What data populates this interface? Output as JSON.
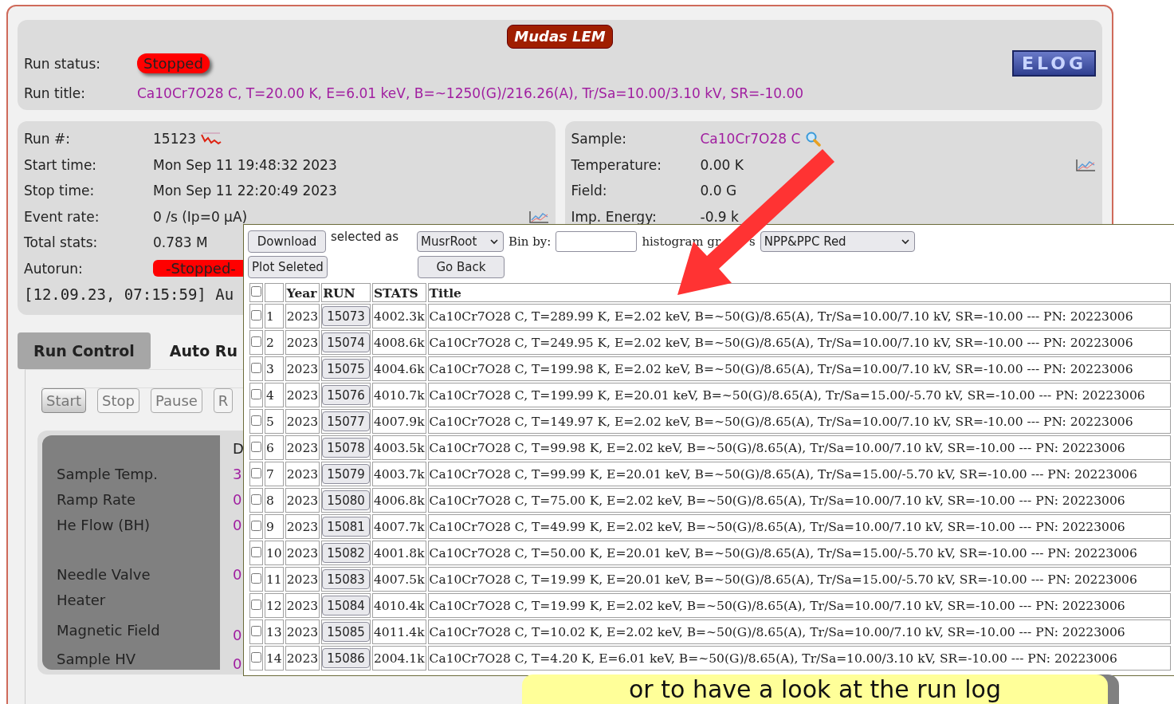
{
  "banner": "Mudas LEM",
  "logo": "ELOG",
  "run_status": {
    "label": "Run status:",
    "value": "Stopped"
  },
  "run_title": {
    "label": "Run title:",
    "value": "Ca10Cr7O28 C, T=20.00 K, E=6.01 keV, B=~1250(G)/216.26(A), Tr/Sa=10.00/3.10 kV, SR=-10.00"
  },
  "run_info": [
    {
      "kind": "run",
      "label": "Run #:",
      "value": "15123"
    },
    {
      "kind": "plain",
      "label": "Start time:",
      "value": "Mon Sep 11 19:48:32 2023"
    },
    {
      "kind": "plain",
      "label": "Stop time:",
      "value": "Mon Sep 11 22:20:49 2023"
    },
    {
      "kind": "rate",
      "label": "Event rate:",
      "value": "0 /s (Ip=0 μA)"
    },
    {
      "kind": "plain",
      "label": "Total stats:",
      "value": "0.783 M"
    },
    {
      "kind": "pill",
      "label": "Autorun:",
      "value": "-Stopped-"
    },
    {
      "kind": "log",
      "value": "[12.09.23, 07:15:59] Au"
    }
  ],
  "sample_info": [
    {
      "kind": "sample",
      "label": "Sample:",
      "value": "Ca10Cr7O28 C"
    },
    {
      "kind": "chart",
      "label": "Temperature:",
      "value": "0.00 K"
    },
    {
      "kind": "plain",
      "label": "Field:",
      "value": "0.0 G"
    },
    {
      "kind": "plain",
      "label": "Imp. Energy:",
      "value": "-0.9 k"
    }
  ],
  "tabs": [
    {
      "label": "Run Control",
      "selected": true
    },
    {
      "label": "Auto Ru",
      "selected": false
    }
  ],
  "controls": [
    {
      "label": "Start",
      "disabled": false
    },
    {
      "label": "Stop",
      "disabled": true
    },
    {
      "label": "Pause",
      "disabled": true
    },
    {
      "label": "R",
      "disabled": true
    }
  ],
  "readouts": {
    "header": "D",
    "rows": [
      {
        "label": "Sample Temp.",
        "value": "3"
      },
      {
        "label": "Ramp Rate",
        "value": "0"
      },
      {
        "label": "He Flow (BH)",
        "value": "0"
      },
      {
        "label": "Needle Valve",
        "value": "0"
      },
      {
        "label": "Heater"
      },
      {
        "label": "Magnetic Field",
        "value": "0"
      },
      {
        "label": "Sample HV",
        "value": "0"
      }
    ]
  },
  "popup": {
    "download": "Download",
    "selected_as": "selected as",
    "format": "MusrRoot",
    "bin_by": "Bin by:",
    "histogram_left": "histogram gr",
    "histogram_right": "s",
    "grouping": "NPP&PPC Red",
    "plot": "Plot Seleted",
    "back": "Go Back",
    "select_all": {
      "checked": false
    },
    "columns": [
      "Year",
      "RUN",
      "STATS",
      "Title"
    ],
    "rows": [
      {
        "checked": false,
        "n": "1",
        "year": "2023",
        "run": "15073",
        "stats": "4002.3k",
        "title": "Ca10Cr7O28 C, T=289.99 K, E=2.02 keV, B=~50(G)/8.65(A), Tr/Sa=10.00/7.10 kV, SR=-10.00 --- PN: 20223006"
      },
      {
        "checked": false,
        "n": "2",
        "year": "2023",
        "run": "15074",
        "stats": "4008.6k",
        "title": "Ca10Cr7O28 C, T=249.95 K, E=2.02 keV, B=~50(G)/8.65(A), Tr/Sa=10.00/7.10 kV, SR=-10.00 --- PN: 20223006"
      },
      {
        "checked": false,
        "n": "3",
        "year": "2023",
        "run": "15075",
        "stats": "4004.6k",
        "title": "Ca10Cr7O28 C, T=199.98 K, E=2.02 keV, B=~50(G)/8.65(A), Tr/Sa=10.00/7.10 kV, SR=-10.00 --- PN: 20223006"
      },
      {
        "checked": false,
        "n": "4",
        "year": "2023",
        "run": "15076",
        "stats": "4010.7k",
        "title": "Ca10Cr7O28 C, T=199.99 K, E=20.01 keV, B=~50(G)/8.65(A), Tr/Sa=15.00/-5.70 kV, SR=-10.00 --- PN: 20223006"
      },
      {
        "checked": false,
        "n": "5",
        "year": "2023",
        "run": "15077",
        "stats": "4007.9k",
        "title": "Ca10Cr7O28 C, T=149.97 K, E=2.02 keV, B=~50(G)/8.65(A), Tr/Sa=10.00/7.10 kV, SR=-10.00 --- PN: 20223006"
      },
      {
        "checked": false,
        "n": "6",
        "year": "2023",
        "run": "15078",
        "stats": "4003.5k",
        "title": "Ca10Cr7O28 C, T=99.98 K, E=2.02 keV, B=~50(G)/8.65(A), Tr/Sa=10.00/7.10 kV, SR=-10.00 --- PN: 20223006"
      },
      {
        "checked": false,
        "n": "7",
        "year": "2023",
        "run": "15079",
        "stats": "4003.7k",
        "title": "Ca10Cr7O28 C, T=99.99 K, E=20.01 keV, B=~50(G)/8.65(A), Tr/Sa=15.00/-5.70 kV, SR=-10.00 --- PN: 20223006"
      },
      {
        "checked": false,
        "n": "8",
        "year": "2023",
        "run": "15080",
        "stats": "4006.8k",
        "title": "Ca10Cr7O28 C, T=75.00 K, E=2.02 keV, B=~50(G)/8.65(A), Tr/Sa=10.00/7.10 kV, SR=-10.00 --- PN: 20223006"
      },
      {
        "checked": false,
        "n": "9",
        "year": "2023",
        "run": "15081",
        "stats": "4007.7k",
        "title": "Ca10Cr7O28 C, T=49.99 K, E=2.02 keV, B=~50(G)/8.65(A), Tr/Sa=10.00/7.10 kV, SR=-10.00 --- PN: 20223006"
      },
      {
        "checked": false,
        "n": "10",
        "year": "2023",
        "run": "15082",
        "stats": "4001.8k",
        "title": "Ca10Cr7O28 C, T=50.00 K, E=20.01 keV, B=~50(G)/8.65(A), Tr/Sa=15.00/-5.70 kV, SR=-10.00 --- PN: 20223006"
      },
      {
        "checked": false,
        "n": "11",
        "year": "2023",
        "run": "15083",
        "stats": "4007.5k",
        "title": "Ca10Cr7O28 C, T=19.99 K, E=20.01 keV, B=~50(G)/8.65(A), Tr/Sa=15.00/-5.70 kV, SR=-10.00 --- PN: 20223006"
      },
      {
        "checked": false,
        "n": "12",
        "year": "2023",
        "run": "15084",
        "stats": "4010.4k",
        "title": "Ca10Cr7O28 C, T=19.99 K, E=2.02 keV, B=~50(G)/8.65(A), Tr/Sa=10.00/7.10 kV, SR=-10.00 --- PN: 20223006"
      },
      {
        "checked": false,
        "n": "13",
        "year": "2023",
        "run": "15085",
        "stats": "4011.4k",
        "title": "Ca10Cr7O28 C, T=10.02 K, E=2.02 keV, B=~50(G)/8.65(A), Tr/Sa=10.00/7.10 kV, SR=-10.00 --- PN: 20223006"
      },
      {
        "checked": false,
        "n": "14",
        "year": "2023",
        "run": "15086",
        "stats": "2004.1k",
        "title": "Ca10Cr7O28 C, T=4.20 K, E=6.01 keV, B=~50(G)/8.65(A), Tr/Sa=10.00/3.10 kV, SR=-10.00 --- PN: 20223006"
      }
    ]
  },
  "caption": "or to have a look at the run log"
}
